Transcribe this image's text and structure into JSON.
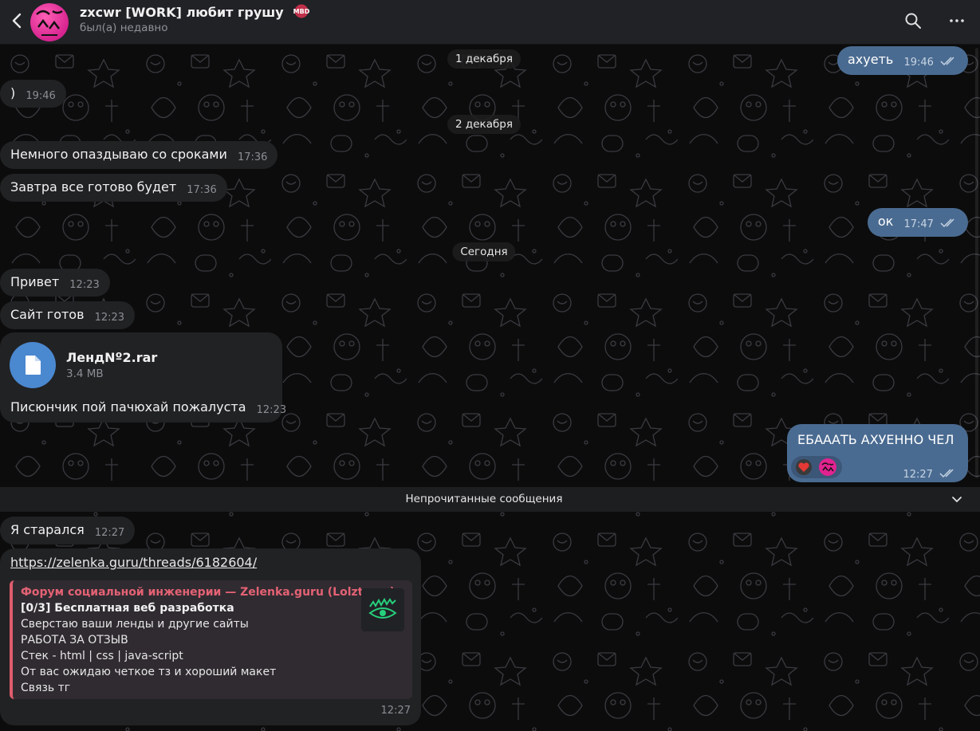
{
  "header": {
    "title": "zxcwr [WORK] любит грушу",
    "badge_text": "МВD",
    "status": "был(а) недавно",
    "back_icon": "back-arrow-icon",
    "search_icon": "search-icon",
    "menu_icon": "more-vertical-icon"
  },
  "date_separators": {
    "d1": "1 декабря",
    "d2": "2 декабря",
    "d3": "Сегодня"
  },
  "messages": {
    "m1": {
      "text": "ахуеть",
      "time": "19:46",
      "direction": "out",
      "read": true
    },
    "m2": {
      "text": ")",
      "time": "19:46",
      "direction": "in"
    },
    "m3": {
      "text": "Немного опаздываю со сроками",
      "time": "17:36",
      "direction": "in"
    },
    "m4": {
      "text": "Завтра все готово будет",
      "time": "17:36",
      "direction": "in"
    },
    "m5": {
      "text": "ок",
      "time": "17:47",
      "direction": "out",
      "read": true
    },
    "m6": {
      "text": "Привет",
      "time": "12:23",
      "direction": "in"
    },
    "m7": {
      "text": "Сайт готов",
      "time": "12:23",
      "direction": "in"
    },
    "m8": {
      "file_name": "ЛендNº2.rar",
      "file_size": "3.4 MB",
      "caption": "Писюнчик пой пачюхай пожалуста",
      "time": "12:23",
      "direction": "in",
      "icon": "file-icon"
    },
    "m9": {
      "text": "ЕБАААТЬ АХУЕННО ЧЕЛ",
      "time": "12:27",
      "direction": "out",
      "read": true,
      "reactions": [
        "heart-reaction-icon",
        "avatar-reaction-icon"
      ]
    },
    "m10": {
      "text": "Я старался",
      "time": "12:27",
      "direction": "in"
    },
    "m11": {
      "link": "https://zelenka.guru/threads/6182604/",
      "preview": {
        "site": "Форум социальной инженерии —  Zelenka.guru (Lolzteam)",
        "title": "[0/3] Бесплатная веб разработка",
        "lines": [
          "Сверстаю ваши ленды и другие сайты",
          "РАБОТА ЗА ОТЗЫВ",
          "Стек - html | css | java-script",
          "От вас ожидаю четкое тз и хороший макет",
          "Связь тг"
        ],
        "thumb_icon": "eye-logo-icon"
      },
      "time": "12:27",
      "direction": "in"
    }
  },
  "unread": {
    "label": "Непрочитанные сообщения",
    "icon": "chevron-down-icon"
  },
  "colors": {
    "incoming": "#212224",
    "outgoing": "#4a6b91",
    "accent": "#4a88d0",
    "preview_bar": "#e05c6e"
  }
}
